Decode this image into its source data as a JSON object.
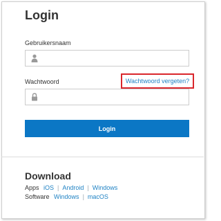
{
  "login": {
    "title": "Login",
    "username_label": "Gebruikersnaam",
    "username_icon": "user-icon",
    "password_label": "Wachtwoord",
    "password_icon": "lock-icon",
    "forgot_link": "Wachtwoord vergeten?",
    "submit_label": "Login"
  },
  "download": {
    "title": "Download",
    "apps_label": "Apps",
    "apps_links": [
      "iOS",
      "Android",
      "Windows"
    ],
    "software_label": "Software",
    "software_links": [
      "Windows",
      "macOS"
    ]
  },
  "colors": {
    "link": "#1f82c4",
    "button": "#0b77c5",
    "highlight": "#d9262b"
  }
}
